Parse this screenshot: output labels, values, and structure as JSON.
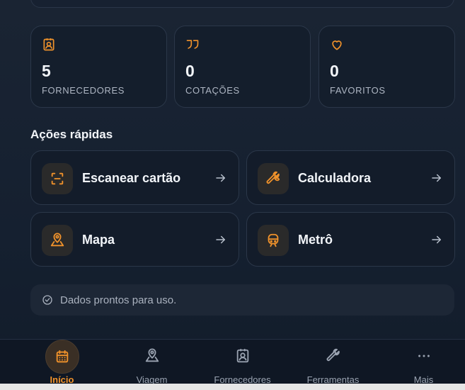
{
  "stats": [
    {
      "value": "5",
      "label": "FORNECEDORES",
      "icon": "contact-badge-icon"
    },
    {
      "value": "0",
      "label": "COTAÇÕES",
      "icon": "quote-icon"
    },
    {
      "value": "0",
      "label": "FAVORITOS",
      "icon": "heart-icon"
    }
  ],
  "quick_actions": {
    "title": "Ações rápidas",
    "items": [
      {
        "label": "Escanear cartão",
        "icon": "scan-icon"
      },
      {
        "label": "Calculadora",
        "icon": "wrench-icon"
      },
      {
        "label": "Mapa",
        "icon": "map-pin-icon"
      },
      {
        "label": "Metrô",
        "icon": "train-icon"
      }
    ]
  },
  "status": {
    "text": "Dados prontos para uso.",
    "icon": "check-circle-icon"
  },
  "nav": {
    "items": [
      {
        "label": "Início",
        "icon": "calendar-icon",
        "active": true
      },
      {
        "label": "Viagem",
        "icon": "map-pin-icon"
      },
      {
        "label": "Fornecedores",
        "icon": "contact-badge-icon"
      },
      {
        "label": "Ferramentas",
        "icon": "wrench-icon"
      },
      {
        "label": "Mais",
        "icon": "more-icon"
      }
    ]
  },
  "colors": {
    "accent": "#f0922b",
    "background": "#16202e",
    "card": "#141e2c",
    "border": "#2b3749",
    "muted_text": "#aeb6c3"
  }
}
